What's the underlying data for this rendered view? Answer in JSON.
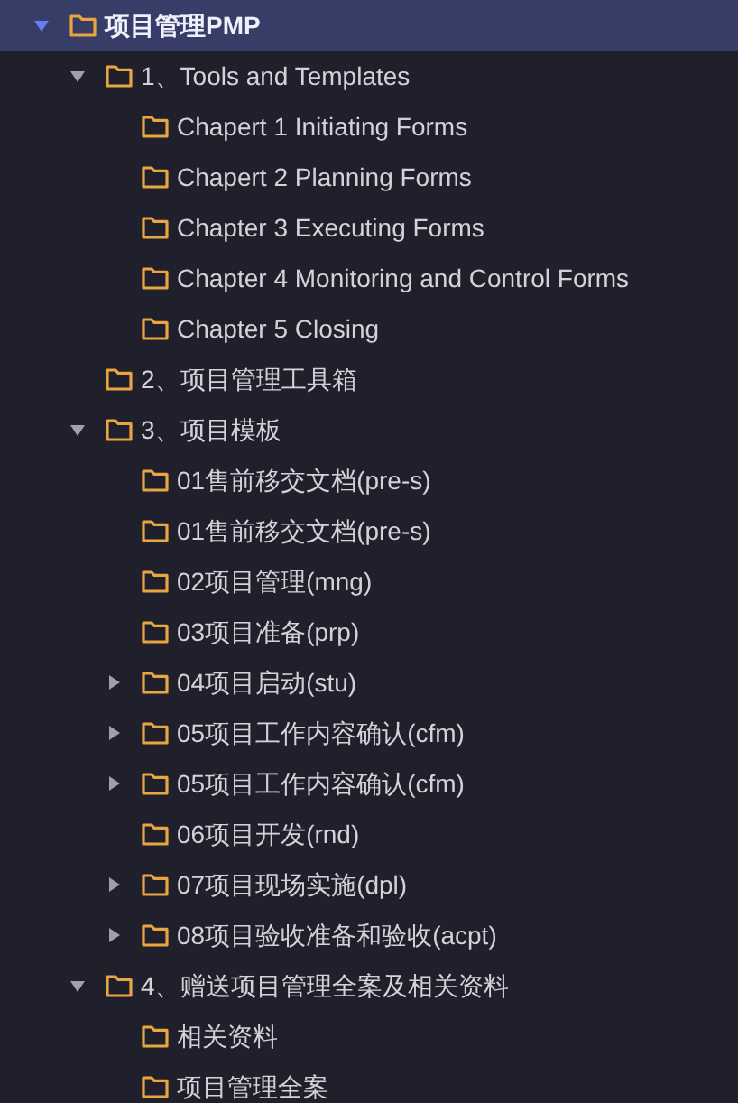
{
  "tree": [
    {
      "label": "项目管理PMP",
      "selected": true,
      "expandable": true,
      "expanded": true,
      "children": [
        {
          "label": "1、Tools and Templates",
          "selected": false,
          "expandable": true,
          "expanded": true,
          "children": [
            {
              "label": "Chapert 1 Initiating Forms",
              "selected": false,
              "expandable": false,
              "expanded": false
            },
            {
              "label": "Chapert 2 Planning Forms",
              "selected": false,
              "expandable": false,
              "expanded": false
            },
            {
              "label": "Chapter 3 Executing Forms",
              "selected": false,
              "expandable": false,
              "expanded": false
            },
            {
              "label": "Chapter 4 Monitoring and Control Forms",
              "selected": false,
              "expandable": false,
              "expanded": false
            },
            {
              "label": "Chapter 5 Closing",
              "selected": false,
              "expandable": false,
              "expanded": false
            }
          ]
        },
        {
          "label": "2、项目管理工具箱",
          "selected": false,
          "expandable": false,
          "expanded": false
        },
        {
          "label": "3、项目模板",
          "selected": false,
          "expandable": true,
          "expanded": true,
          "children": [
            {
              "label": "01售前移交文档(pre-s)",
              "selected": false,
              "expandable": false,
              "expanded": false
            },
            {
              "label": "01售前移交文档(pre-s)",
              "selected": false,
              "expandable": false,
              "expanded": false
            },
            {
              "label": "02项目管理(mng)",
              "selected": false,
              "expandable": false,
              "expanded": false
            },
            {
              "label": "03项目准备(prp)",
              "selected": false,
              "expandable": false,
              "expanded": false
            },
            {
              "label": "04项目启动(stu)",
              "selected": false,
              "expandable": true,
              "expanded": false
            },
            {
              "label": "05项目工作内容确认(cfm)",
              "selected": false,
              "expandable": true,
              "expanded": false
            },
            {
              "label": "05项目工作内容确认(cfm)",
              "selected": false,
              "expandable": true,
              "expanded": false
            },
            {
              "label": "06项目开发(rnd)",
              "selected": false,
              "expandable": false,
              "expanded": false
            },
            {
              "label": "07项目现场实施(dpl)",
              "selected": false,
              "expandable": true,
              "expanded": false
            },
            {
              "label": "08项目验收准备和验收(acpt)",
              "selected": false,
              "expandable": true,
              "expanded": false
            }
          ]
        },
        {
          "label": "4、赠送项目管理全案及相关资料",
          "selected": false,
          "expandable": true,
          "expanded": true,
          "children": [
            {
              "label": "相关资料",
              "selected": false,
              "expandable": false,
              "expanded": false
            },
            {
              "label": "项目管理全案",
              "selected": false,
              "expandable": false,
              "expanded": false
            }
          ]
        }
      ]
    }
  ]
}
